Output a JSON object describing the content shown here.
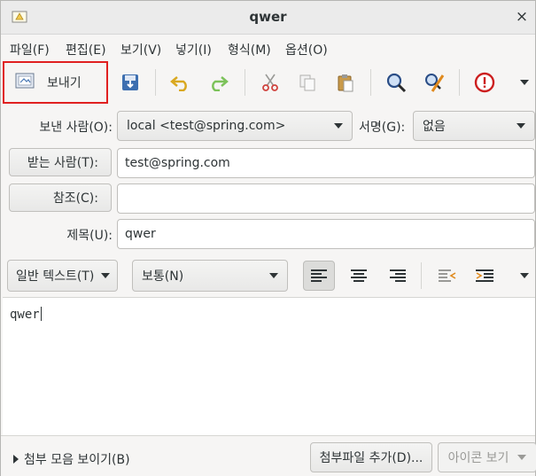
{
  "window": {
    "title": "qwer",
    "close_glyph": "×",
    "app_icon": "compose-mail-icon"
  },
  "menubar": [
    {
      "label": "파일(F)"
    },
    {
      "label": "편집(E)"
    },
    {
      "label": "보기(V)"
    },
    {
      "label": "넣기(I)"
    },
    {
      "label": "형식(M)"
    },
    {
      "label": "옵션(O)"
    }
  ],
  "toolbar": {
    "send_label": "보내기",
    "icons": [
      "send-mail-icon",
      "save-draft-icon",
      "undo-icon",
      "redo-icon",
      "cut-icon",
      "copy-icon",
      "paste-icon",
      "find-icon",
      "spell-check-icon",
      "priority-icon",
      "overflow-menu-icon"
    ]
  },
  "header": {
    "from_label": "보낸 사람(O):",
    "from_value": "local <test@spring.com>",
    "signature_label": "서명(G):",
    "signature_value": "없음",
    "to_button": "받는 사람(T):",
    "to_value": "test@spring.com",
    "cc_button": "참조(C):",
    "cc_value": "",
    "subject_label": "제목(U):",
    "subject_value": "qwer"
  },
  "format": {
    "mode": "일반 텍스트(T)",
    "paragraph": "보통(N)",
    "align": "left"
  },
  "editor": {
    "body": "qwer"
  },
  "bottom": {
    "attachments_toggle": "첨부 모음 보이기(B)",
    "add_attachment": "첨부파일 추가(D)...",
    "icon_view": "아이콘 보기"
  }
}
